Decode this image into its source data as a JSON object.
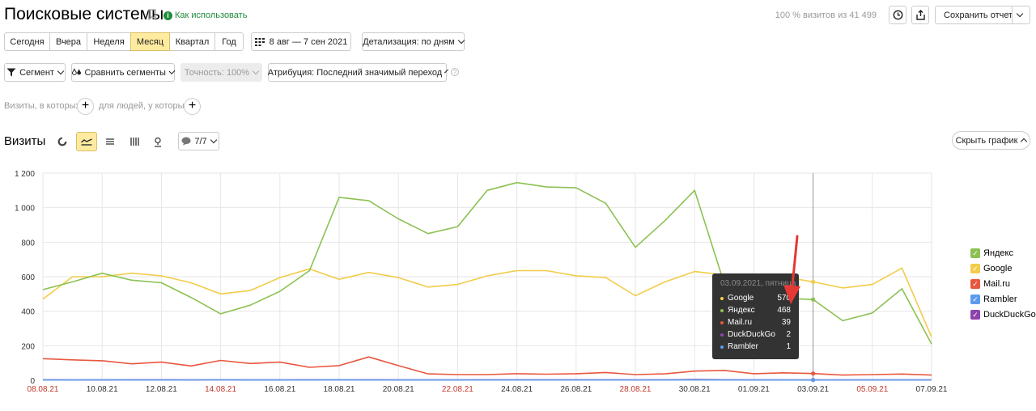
{
  "header": {
    "title": "Поисковые системы",
    "how_to_use": "Как использовать",
    "visits_summary": "100 % визитов из 41 499",
    "save_report": "Сохранить отчет"
  },
  "period_tabs": [
    "Сегодня",
    "Вчера",
    "Неделя",
    "Месяц",
    "Квартал",
    "Год"
  ],
  "active_period": "Месяц",
  "date_range": "8 авг — 7 сен 2021",
  "detail": "Детализация: по дням",
  "toolbar2": {
    "segment": "Сегмент",
    "compare": "Сравнить сегменты",
    "accuracy": "Точность: 100%",
    "attribution": "Атрибуция: Последний значимый переход"
  },
  "filters": {
    "visits_where": "Визиты, в которых",
    "people_where": "для людей, у которых"
  },
  "chart_section": {
    "title": "Визиты",
    "series_count": "7/7",
    "hide_chart": "Скрыть график"
  },
  "colors": {
    "yandex": "#8cc152",
    "google": "#f2cc4a",
    "mailru": "#e9573f",
    "rambler": "#5d9cec",
    "duckduckgo": "#8e44ad",
    "accent_active": "#ffeba0",
    "weekend_label": "#c0392b"
  },
  "tooltip": {
    "date": "03.09.2021, пятница",
    "rows": [
      {
        "name": "Google",
        "value": "570",
        "color": "#f2cc4a"
      },
      {
        "name": "Яндекс",
        "value": "468",
        "color": "#8cc152"
      },
      {
        "name": "Mail.ru",
        "value": "39",
        "color": "#e9573f"
      },
      {
        "name": "DuckDuckGo",
        "value": "2",
        "color": "#8e44ad"
      },
      {
        "name": "Rambler",
        "value": "1",
        "color": "#5d9cec"
      }
    ]
  },
  "chart_data": {
    "type": "line",
    "x": [
      "08.08.21",
      "09.08.21",
      "10.08.21",
      "11.08.21",
      "12.08.21",
      "13.08.21",
      "14.08.21",
      "15.08.21",
      "16.08.21",
      "17.08.21",
      "18.08.21",
      "19.08.21",
      "20.08.21",
      "21.08.21",
      "22.08.21",
      "23.08.21",
      "24.08.21",
      "25.08.21",
      "26.08.21",
      "27.08.21",
      "28.08.21",
      "29.08.21",
      "30.08.21",
      "31.08.21",
      "01.09.21",
      "02.09.21",
      "03.09.21",
      "04.09.21",
      "05.09.21",
      "06.09.21",
      "07.09.21"
    ],
    "x_tick_labels": [
      "08.08.21",
      "10.08.21",
      "12.08.21",
      "14.08.21",
      "16.08.21",
      "18.08.21",
      "20.08.21",
      "22.08.21",
      "24.08.21",
      "26.08.21",
      "28.08.21",
      "30.08.21",
      "01.09.21",
      "03.09.21",
      "05.09.21",
      "07.09.21"
    ],
    "weekend_ticks": [
      "08.08.21",
      "14.08.21",
      "22.08.21",
      "28.08.21",
      "05.09.21"
    ],
    "ylim": [
      0,
      1200
    ],
    "y_ticks": [
      "0",
      "200",
      "400",
      "600",
      "800",
      "1 000",
      "1 200"
    ],
    "y_tick_values": [
      0,
      200,
      400,
      600,
      800,
      1000,
      1200
    ],
    "series": [
      {
        "name": "Яндекс",
        "key": "yandex",
        "values": [
          525,
          570,
          620,
          580,
          565,
          480,
          385,
          435,
          515,
          635,
          1060,
          1040,
          935,
          850,
          890,
          1100,
          1145,
          1120,
          1115,
          1025,
          770,
          925,
          1100,
          560,
          500,
          475,
          468,
          345,
          390,
          530,
          210
        ]
      },
      {
        "name": "Google",
        "key": "google",
        "values": [
          470,
          600,
          600,
          620,
          605,
          565,
          500,
          520,
          595,
          645,
          585,
          625,
          595,
          540,
          555,
          605,
          635,
          635,
          605,
          595,
          490,
          570,
          630,
          610,
          585,
          600,
          570,
          535,
          555,
          650,
          250
        ]
      },
      {
        "name": "Mail.ru",
        "key": "mailru",
        "values": [
          125,
          118,
          113,
          95,
          105,
          83,
          115,
          97,
          105,
          75,
          85,
          135,
          85,
          37,
          33,
          33,
          38,
          35,
          38,
          45,
          33,
          37,
          53,
          57,
          38,
          43,
          39,
          30,
          33,
          36,
          30
        ]
      },
      {
        "name": "Rambler",
        "key": "rambler",
        "values": [
          2,
          2,
          3,
          2,
          2,
          2,
          3,
          2,
          2,
          2,
          3,
          2,
          2,
          2,
          2,
          2,
          2,
          2,
          2,
          2,
          2,
          2,
          2,
          2,
          2,
          2,
          1,
          2,
          2,
          2,
          2
        ]
      },
      {
        "name": "DuckDuckGo",
        "key": "duckduckgo",
        "values": [
          3,
          2,
          2,
          3,
          3,
          2,
          3,
          2,
          2,
          3,
          3,
          3,
          2,
          2,
          2,
          3,
          3,
          3,
          3,
          3,
          2,
          3,
          4,
          3,
          2,
          2,
          2,
          2,
          2,
          2,
          2
        ]
      }
    ],
    "highlight_x": "03.09.21",
    "grid": true,
    "legend": "right"
  }
}
